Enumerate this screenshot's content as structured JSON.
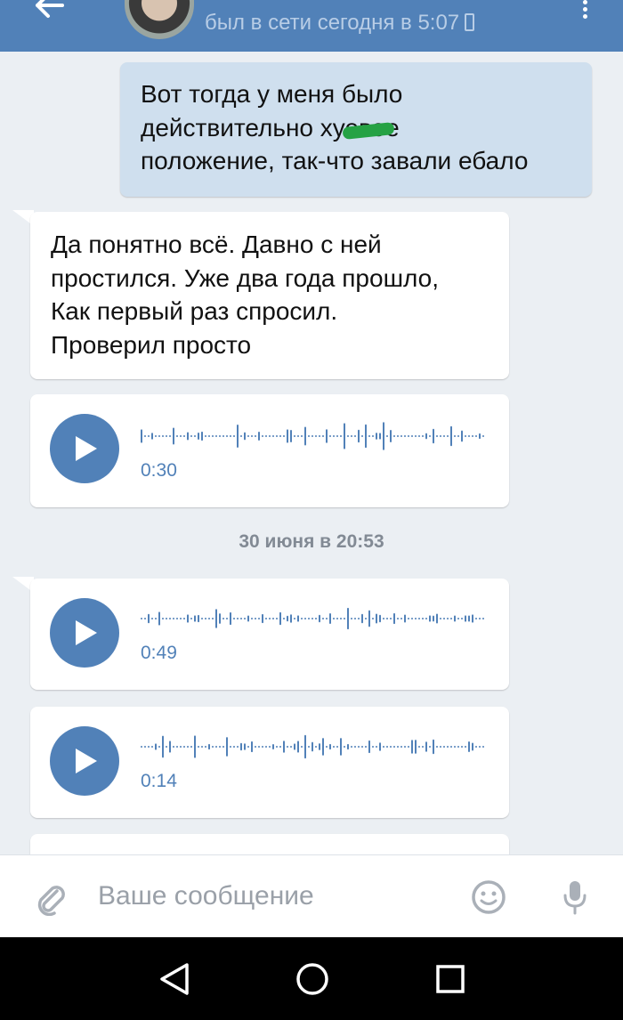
{
  "header": {
    "status": "был в сети сегодня в 5:07"
  },
  "messages": [
    {
      "type": "text",
      "direction": "out",
      "lines": [
        "Вот тогда у меня было",
        "действительно хуевое",
        "положение, так-что завали ебало"
      ]
    },
    {
      "type": "text",
      "direction": "in",
      "lines": [
        "Да понятно всё. Давно с ней",
        "простился. Уже два года прошло,",
        "Как первый раз спросил.",
        "Проверил просто"
      ]
    },
    {
      "type": "voice",
      "direction": "in",
      "duration": "0:30"
    },
    {
      "type": "date",
      "label": "30 июня в 20:53"
    },
    {
      "type": "voice",
      "direction": "in",
      "duration": "0:49"
    },
    {
      "type": "voice",
      "direction": "in",
      "duration": "0:14"
    }
  ],
  "input": {
    "placeholder": "Ваше сообщение"
  },
  "colors": {
    "header": "#5181b8",
    "accent": "#5181b8",
    "outgoing_bubble": "#cfdfee",
    "incoming_bubble": "#ffffff",
    "background": "#ebeff3"
  },
  "icons": [
    "back-arrow-icon",
    "phone-icon",
    "more-icon",
    "play-icon",
    "attach-icon",
    "emoji-icon",
    "mic-icon",
    "nav-back-icon",
    "nav-home-icon",
    "nav-recent-icon"
  ]
}
